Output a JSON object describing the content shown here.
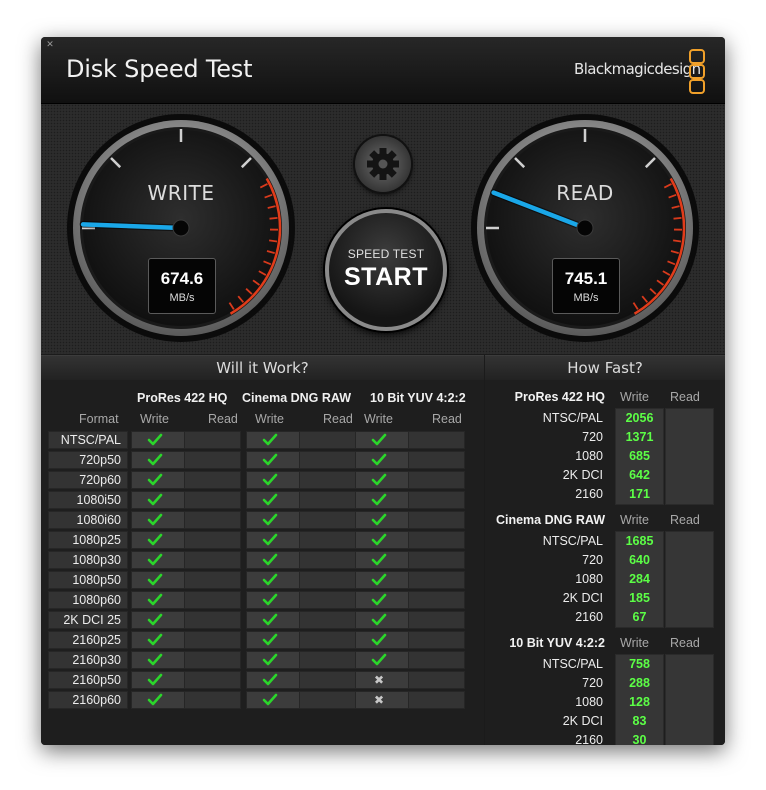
{
  "window": {
    "title": "Disk Speed Test",
    "brand": "Blackmagicdesign",
    "accent_color": "#f0a02a",
    "needle_color": "#1aa7e8",
    "value_color": "#5cff46"
  },
  "gauges": {
    "write": {
      "label": "WRITE",
      "value": "674.6",
      "unit": "MB/s"
    },
    "read": {
      "label": "READ",
      "value": "745.1",
      "unit": "MB/s"
    }
  },
  "controls": {
    "settings_icon": "gear-icon",
    "start_top": "SPEED TEST",
    "start_main": "START"
  },
  "will_it_work": {
    "title": "Will it Work?",
    "format_header": "Format",
    "write_label": "Write",
    "read_label": "Read",
    "groups": [
      "ProRes 422 HQ",
      "Cinema DNG RAW",
      "10 Bit YUV 4:2:2"
    ],
    "rows": [
      {
        "format": "NTSC/PAL",
        "results": [
          "check",
          "check",
          "check"
        ]
      },
      {
        "format": "720p50",
        "results": [
          "check",
          "check",
          "check"
        ]
      },
      {
        "format": "720p60",
        "results": [
          "check",
          "check",
          "check"
        ]
      },
      {
        "format": "1080i50",
        "results": [
          "check",
          "check",
          "check"
        ]
      },
      {
        "format": "1080i60",
        "results": [
          "check",
          "check",
          "check"
        ]
      },
      {
        "format": "1080p25",
        "results": [
          "check",
          "check",
          "check"
        ]
      },
      {
        "format": "1080p30",
        "results": [
          "check",
          "check",
          "check"
        ]
      },
      {
        "format": "1080p50",
        "results": [
          "check",
          "check",
          "check"
        ]
      },
      {
        "format": "1080p60",
        "results": [
          "check",
          "check",
          "check"
        ]
      },
      {
        "format": "2K DCI 25",
        "results": [
          "check",
          "check",
          "check"
        ]
      },
      {
        "format": "2160p25",
        "results": [
          "check",
          "check",
          "check"
        ]
      },
      {
        "format": "2160p30",
        "results": [
          "check",
          "check",
          "check"
        ]
      },
      {
        "format": "2160p50",
        "results": [
          "check",
          "check",
          "cross"
        ]
      },
      {
        "format": "2160p60",
        "results": [
          "check",
          "check",
          "cross"
        ]
      }
    ]
  },
  "how_fast": {
    "title": "How Fast?",
    "write_label": "Write",
    "read_label": "Read",
    "groups": [
      {
        "name": "ProRes 422 HQ",
        "rows": [
          {
            "label": "NTSC/PAL",
            "write": "2056"
          },
          {
            "label": "720",
            "write": "1371"
          },
          {
            "label": "1080",
            "write": "685"
          },
          {
            "label": "2K DCI",
            "write": "642"
          },
          {
            "label": "2160",
            "write": "171"
          }
        ]
      },
      {
        "name": "Cinema DNG RAW",
        "rows": [
          {
            "label": "NTSC/PAL",
            "write": "1685"
          },
          {
            "label": "720",
            "write": "640"
          },
          {
            "label": "1080",
            "write": "284"
          },
          {
            "label": "2K DCI",
            "write": "185"
          },
          {
            "label": "2160",
            "write": "67"
          }
        ]
      },
      {
        "name": "10 Bit YUV 4:2:2",
        "rows": [
          {
            "label": "NTSC/PAL",
            "write": "758"
          },
          {
            "label": "720",
            "write": "288"
          },
          {
            "label": "1080",
            "write": "128"
          },
          {
            "label": "2K DCI",
            "write": "83"
          },
          {
            "label": "2160",
            "write": "30"
          }
        ]
      }
    ]
  }
}
